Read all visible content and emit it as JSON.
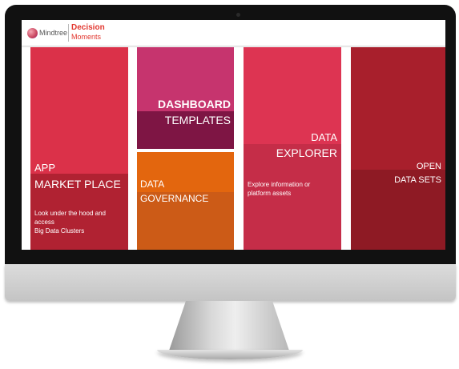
{
  "header": {
    "logo_text": "Mindtree",
    "brand_title": "Decision",
    "brand_subtitle": "Moments"
  },
  "tiles": [
    {
      "id": "app-market-place",
      "line1": "APP",
      "line2": "MARKET PLACE",
      "description_line1": "Look under the hood and access",
      "description_line2": "Big Data Clusters",
      "color": "#db3149"
    },
    {
      "id": "dashboard-templates",
      "line1": "DASHBOARD",
      "line2": "TEMPLATES",
      "color": "#c6346e"
    },
    {
      "id": "data-governance",
      "line1": "DATA",
      "line2": "GOVERNANCE",
      "color": "#e3660e"
    },
    {
      "id": "data-explorer",
      "line1": "DATA",
      "line2": "EXPLORER",
      "description_line1": "Explore information or",
      "description_line2": "platform assets",
      "color": "#dd3452"
    },
    {
      "id": "open-data-sets",
      "line1": "OPEN",
      "line2": "DATA SETS",
      "color": "#a81f2c"
    }
  ]
}
